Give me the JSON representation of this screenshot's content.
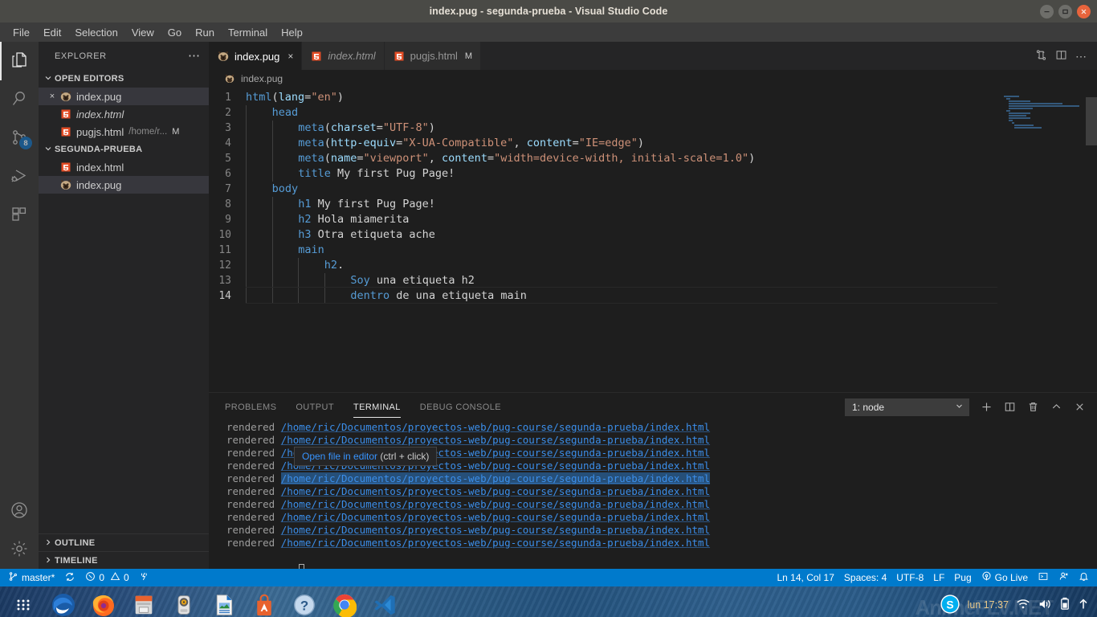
{
  "window": {
    "title": "index.pug - segunda-prueba - Visual Studio Code",
    "minimize_label": "–",
    "maximize_label": "□",
    "close_label": "×"
  },
  "menubar": {
    "items": [
      "File",
      "Edit",
      "Selection",
      "View",
      "Go",
      "Run",
      "Terminal",
      "Help"
    ]
  },
  "activitybar": {
    "items": [
      {
        "name": "explorer",
        "icon": "files-icon",
        "badge": ""
      },
      {
        "name": "search",
        "icon": "search-icon",
        "badge": ""
      },
      {
        "name": "source-control",
        "icon": "source-control-icon",
        "badge": "8"
      },
      {
        "name": "run-and-debug",
        "icon": "debug-icon",
        "badge": ""
      },
      {
        "name": "extensions",
        "icon": "extensions-icon",
        "badge": ""
      }
    ],
    "bottom": [
      {
        "name": "accounts",
        "icon": "account-icon"
      },
      {
        "name": "manage",
        "icon": "gear-icon"
      }
    ]
  },
  "sidebar": {
    "header": "EXPLORER",
    "more_actions": "⋯",
    "open_editors": {
      "label": "OPEN EDITORS",
      "chevron": "⌄",
      "items": [
        {
          "name": "index.pug",
          "icon": "pug-icon",
          "close": "×",
          "italic": false,
          "path": "",
          "flag": "",
          "selected": true
        },
        {
          "name": "index.html",
          "icon": "html-icon",
          "close": "",
          "italic": true,
          "path": "",
          "flag": "",
          "selected": false
        },
        {
          "name": "pugjs.html",
          "icon": "html-icon",
          "close": "",
          "italic": false,
          "path": "/home/r...",
          "flag": "M",
          "selected": false
        }
      ]
    },
    "folder": {
      "label": "SEGUNDA-PRUEBA",
      "chevron": "⌄",
      "items": [
        {
          "name": "index.html",
          "icon": "html-icon",
          "selected": false
        },
        {
          "name": "index.pug",
          "icon": "pug-icon",
          "selected": true
        }
      ]
    },
    "bottom_sections": [
      {
        "label": "OUTLINE",
        "chevron": "›"
      },
      {
        "label": "TIMELINE",
        "chevron": "›"
      }
    ]
  },
  "tabs": [
    {
      "label": "index.pug",
      "icon": "pug-icon",
      "active": true,
      "italic": false,
      "close": "×",
      "modified": ""
    },
    {
      "label": "index.html",
      "icon": "html-icon",
      "active": false,
      "italic": true,
      "close": "",
      "modified": ""
    },
    {
      "label": "pugjs.html",
      "icon": "html-icon",
      "active": false,
      "italic": false,
      "close": "",
      "modified": "M"
    }
  ],
  "editor_actions": [
    {
      "name": "split-pug-preview-icon",
      "glyph": "⇄"
    },
    {
      "name": "split-editor-icon",
      "glyph": "◫"
    },
    {
      "name": "more-actions-icon",
      "glyph": "⋯"
    }
  ],
  "breadcrumb": {
    "icon": "pug-icon",
    "label": "index.pug"
  },
  "code": {
    "language": "pug",
    "lines": [
      {
        "n": 1,
        "indent": 0,
        "tokens": [
          {
            "t": "tag",
            "v": "html"
          },
          {
            "t": "punc",
            "v": "("
          },
          {
            "t": "attr",
            "v": "lang"
          },
          {
            "t": "op",
            "v": "="
          },
          {
            "t": "str",
            "v": "\"en\""
          },
          {
            "t": "punc",
            "v": ")"
          }
        ]
      },
      {
        "n": 2,
        "indent": 1,
        "tokens": [
          {
            "t": "tag",
            "v": "head"
          }
        ]
      },
      {
        "n": 3,
        "indent": 2,
        "tokens": [
          {
            "t": "tag",
            "v": "meta"
          },
          {
            "t": "punc",
            "v": "("
          },
          {
            "t": "attr",
            "v": "charset"
          },
          {
            "t": "op",
            "v": "="
          },
          {
            "t": "str",
            "v": "\"UTF-8\""
          },
          {
            "t": "punc",
            "v": ")"
          }
        ]
      },
      {
        "n": 4,
        "indent": 2,
        "tokens": [
          {
            "t": "tag",
            "v": "meta"
          },
          {
            "t": "punc",
            "v": "("
          },
          {
            "t": "attr",
            "v": "http-equiv"
          },
          {
            "t": "op",
            "v": "="
          },
          {
            "t": "str",
            "v": "\"X-UA-Compatible\""
          },
          {
            "t": "punc",
            "v": ", "
          },
          {
            "t": "attr",
            "v": "content"
          },
          {
            "t": "op",
            "v": "="
          },
          {
            "t": "str",
            "v": "\"IE=edge\""
          },
          {
            "t": "punc",
            "v": ")"
          }
        ]
      },
      {
        "n": 5,
        "indent": 2,
        "tokens": [
          {
            "t": "tag",
            "v": "meta"
          },
          {
            "t": "punc",
            "v": "("
          },
          {
            "t": "attr",
            "v": "name"
          },
          {
            "t": "op",
            "v": "="
          },
          {
            "t": "str",
            "v": "\"viewport\""
          },
          {
            "t": "punc",
            "v": ", "
          },
          {
            "t": "attr",
            "v": "content"
          },
          {
            "t": "op",
            "v": "="
          },
          {
            "t": "str",
            "v": "\"width=device-width, initial-scale=1.0\""
          },
          {
            "t": "punc",
            "v": ")"
          }
        ]
      },
      {
        "n": 6,
        "indent": 2,
        "tokens": [
          {
            "t": "tag",
            "v": "title"
          },
          {
            "t": "txt",
            "v": " My first Pug Page!"
          }
        ]
      },
      {
        "n": 7,
        "indent": 1,
        "tokens": [
          {
            "t": "tag",
            "v": "body"
          }
        ]
      },
      {
        "n": 8,
        "indent": 2,
        "tokens": [
          {
            "t": "tag",
            "v": "h1"
          },
          {
            "t": "txt",
            "v": " My first Pug Page!"
          }
        ]
      },
      {
        "n": 9,
        "indent": 2,
        "tokens": [
          {
            "t": "tag",
            "v": "h2"
          },
          {
            "t": "txt",
            "v": " Hola miamerita"
          }
        ]
      },
      {
        "n": 10,
        "indent": 2,
        "tokens": [
          {
            "t": "tag",
            "v": "h3"
          },
          {
            "t": "txt",
            "v": " Otra etiqueta ache"
          }
        ]
      },
      {
        "n": 11,
        "indent": 2,
        "tokens": [
          {
            "t": "tag",
            "v": "main"
          }
        ]
      },
      {
        "n": 12,
        "indent": 3,
        "tokens": [
          {
            "t": "tag",
            "v": "h2"
          },
          {
            "t": "punc",
            "v": "."
          }
        ]
      },
      {
        "n": 13,
        "indent": 4,
        "tokens": [
          {
            "t": "tag",
            "v": "Soy"
          },
          {
            "t": "txt",
            "v": " una etiqueta h2"
          }
        ]
      },
      {
        "n": 14,
        "indent": 4,
        "tokens": [
          {
            "t": "tag",
            "v": "dentro"
          },
          {
            "t": "txt",
            "v": " de una etiqueta main"
          }
        ],
        "current": true
      }
    ]
  },
  "panel": {
    "tabs": [
      {
        "label": "PROBLEMS",
        "active": false
      },
      {
        "label": "OUTPUT",
        "active": false
      },
      {
        "label": "TERMINAL",
        "active": true
      },
      {
        "label": "DEBUG CONSOLE",
        "active": false
      }
    ],
    "terminal_select": {
      "value": "1: node",
      "chevron": "⌄"
    },
    "actions": [
      {
        "name": "new-terminal-icon",
        "glyph": "+"
      },
      {
        "name": "split-terminal-icon",
        "glyph": "◫"
      },
      {
        "name": "kill-terminal-icon",
        "glyph": "🗑"
      },
      {
        "name": "maximize-panel-icon",
        "glyph": "⌃"
      },
      {
        "name": "close-panel-icon",
        "glyph": "×"
      }
    ],
    "terminal_lines": [
      {
        "label": "rendered",
        "path": "/home/ric/Documentos/proyectos-web/pug-course/segunda-prueba/index.html",
        "highlight": false
      },
      {
        "label": "rendered",
        "path": "/home/ric/Documentos/proyectos-web/pug-course/segunda-prueba/index.html",
        "highlight": false
      },
      {
        "label": "rendered",
        "path": "/home/ric/Documentos/proyectos-web/pug-course/segunda-prueba/index.html",
        "highlight": false
      },
      {
        "label": "rendered",
        "path": "/home/ric/Documentos/proyectos-web/pug-course/segunda-prueba/index.html",
        "highlight": false
      },
      {
        "label": "rendered",
        "path": "/home/ric/Documentos/proyectos-web/pug-course/segunda-prueba/index.html",
        "highlight": true
      },
      {
        "label": "rendered",
        "path": "/home/ric/Documentos/proyectos-web/pug-course/segunda-prueba/index.html",
        "highlight": false
      },
      {
        "label": "rendered",
        "path": "/home/ric/Documentos/proyectos-web/pug-course/segunda-prueba/index.html",
        "highlight": false
      },
      {
        "label": "rendered",
        "path": "/home/ric/Documentos/proyectos-web/pug-course/segunda-prueba/index.html",
        "highlight": false
      },
      {
        "label": "rendered",
        "path": "/home/ric/Documentos/proyectos-web/pug-course/segunda-prueba/index.html",
        "highlight": false
      },
      {
        "label": "rendered",
        "path": "/home/ric/Documentos/proyectos-web/pug-course/segunda-prueba/index.html",
        "highlight": false
      }
    ],
    "tooltip": {
      "link_text": "Open file in editor",
      "hint_text": " (ctrl + click)"
    }
  },
  "statusbar": {
    "left": [
      {
        "name": "branch",
        "icon": "source-control-icon",
        "label": "master*"
      },
      {
        "name": "sync",
        "icon": "sync-icon",
        "label": ""
      },
      {
        "name": "problems",
        "icon": "error-warning-icon",
        "label": "0  0"
      },
      {
        "name": "ports",
        "icon": "radio-tower-icon",
        "label": ""
      }
    ],
    "right": [
      {
        "name": "cursor-position",
        "label": "Ln 14, Col 17"
      },
      {
        "name": "indentation",
        "label": "Spaces: 4"
      },
      {
        "name": "encoding",
        "label": "UTF-8"
      },
      {
        "name": "eol",
        "label": "LF"
      },
      {
        "name": "language-mode",
        "label": "Pug"
      },
      {
        "name": "go-live",
        "label": "Go Live",
        "icon": "broadcast-icon"
      },
      {
        "name": "open-terminal",
        "label": "",
        "icon": "terminal-icon"
      },
      {
        "name": "feedback",
        "label": "",
        "icon": "feedback-icon"
      },
      {
        "name": "notifications",
        "label": "",
        "icon": "bell-icon"
      }
    ],
    "error_count": "0",
    "warning_count": "0"
  },
  "taskbar": {
    "icons": [
      {
        "name": "app-grid-icon",
        "running": false
      },
      {
        "name": "thunderbird-icon",
        "running": false
      },
      {
        "name": "firefox-icon",
        "running": false
      },
      {
        "name": "files-manager-icon",
        "running": true
      },
      {
        "name": "rhythmbox-icon",
        "running": false
      },
      {
        "name": "libreoffice-icon",
        "running": false
      },
      {
        "name": "ubuntu-software-icon",
        "running": false
      },
      {
        "name": "help-icon",
        "running": false
      },
      {
        "name": "chrome-icon",
        "running": true
      },
      {
        "name": "vscode-icon",
        "running": true
      }
    ],
    "tray": {
      "skype_label": "S",
      "clock": "lun 17:37",
      "icons": [
        "wifi-icon",
        "volume-icon",
        "battery-icon",
        "dropdown-icon"
      ]
    },
    "watermark": "AnimeFLV.NET"
  },
  "colors": {
    "accent": "#007acc",
    "titlebar_bg": "#4a4a46",
    "editor_bg": "#1e1e1e",
    "sidebar_bg": "#252526",
    "activitybar_bg": "#333333",
    "tag_color": "#569cd6",
    "attr_color": "#9cdcfe",
    "string_color": "#ce9178",
    "link_color": "#3b8eea",
    "badge_bg": "#0e70c0",
    "close_btn": "#e8643c"
  }
}
